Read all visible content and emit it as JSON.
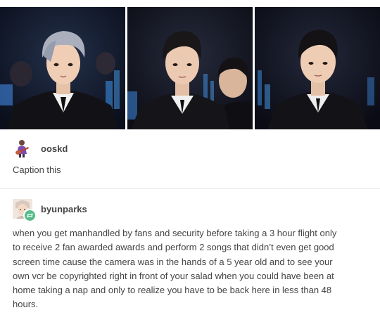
{
  "photos": [
    {
      "icon": "person-photo-silver-hair",
      "accent": "#9aa3b5"
    },
    {
      "icon": "person-photo-dark-hair",
      "accent": "#2c2a2e"
    },
    {
      "icon": "person-photo-dark-hair",
      "accent": "#1f1d20"
    }
  ],
  "post1": {
    "username": "ooskd",
    "caption": "Caption this",
    "avatar_icon": "guitar-player-avatar-icon"
  },
  "post2": {
    "username": "byunparks",
    "avatar_icon": "user-avatar-icon",
    "badge_icon": "reblog-icon",
    "lines": [
      "when you get manhandled by fans and security before taking a 3 hour flight only",
      "to receive 2 fan awarded awards and perform 2 songs that didn’t even get good",
      "screen time cause the camera was in the hands of a 5 year old and to see your",
      "own vcr be copyrighted right in front of your salad when you could have been at",
      "home taking a nap and only to realize you have to be back here in less than 48",
      "hours."
    ]
  },
  "colors": {
    "text": "#444444",
    "reblog_green": "#56bc8a",
    "divider": "#e6e6e6"
  }
}
